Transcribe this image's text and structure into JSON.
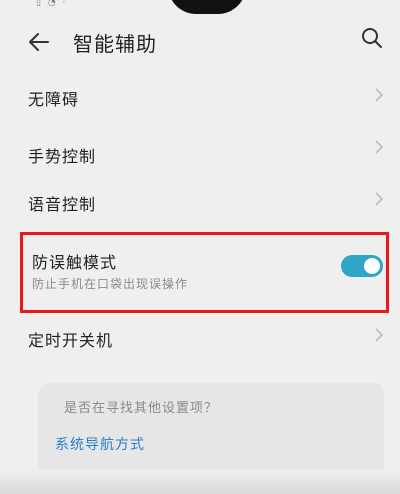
{
  "status_bar": {
    "icons": "▯ ◔ ·"
  },
  "header": {
    "title": "智能辅助"
  },
  "list": {
    "items": [
      {
        "label": "无障碍"
      },
      {
        "label": "手势控制"
      },
      {
        "label": "语音控制"
      }
    ],
    "toggle_row": {
      "title": "防误触模式",
      "subtitle": "防止手机在口袋出现误操作",
      "enabled": true
    },
    "after_items": [
      {
        "label": "定时开关机"
      }
    ]
  },
  "suggestion": {
    "question": "是否在寻找其他设置项？",
    "link": "系统导航方式"
  },
  "colors": {
    "highlight_border": "#e8191b",
    "toggle_on": "#2fa5c8",
    "link": "#2a7ecb"
  }
}
